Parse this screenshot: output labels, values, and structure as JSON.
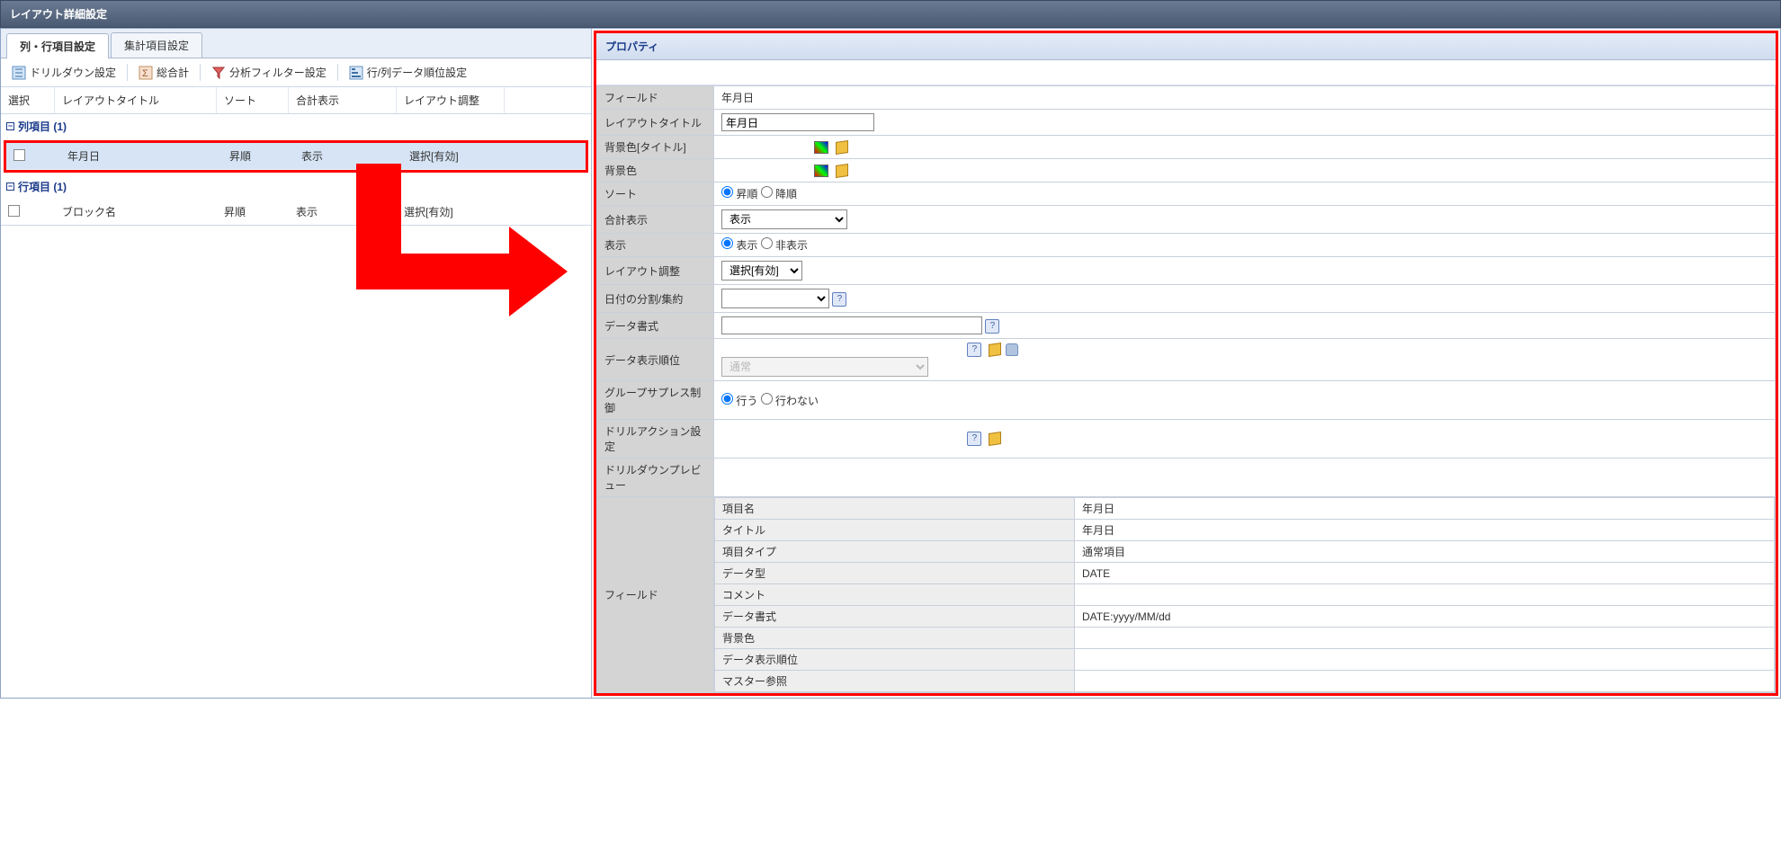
{
  "window": {
    "title": "レイアウト詳細設定"
  },
  "tabs": {
    "tab1": "列・行項目設定",
    "tab2": "集計項目設定"
  },
  "toolbar": {
    "drilldown": "ドリルダウン設定",
    "total": "総合計",
    "filter": "分析フィルター設定",
    "rank": "行/列データ順位設定"
  },
  "grid_headers": {
    "select": "選択",
    "layout_title": "レイアウトタイトル",
    "sort": "ソート",
    "total_display": "合計表示",
    "layout_adjust": "レイアウト調整"
  },
  "groups": {
    "columns": "列項目 (1)",
    "rows": "行項目 (1)"
  },
  "row_col": {
    "title": "年月日",
    "sort": "昇順",
    "total": "表示",
    "adjust": "選択[有効]"
  },
  "row_row": {
    "title": "ブロック名",
    "sort": "昇順",
    "total": "表示",
    "adjust": "選択[有効]"
  },
  "properties": {
    "header": "プロパティ",
    "labels": {
      "field": "フィールド",
      "layout_title": "レイアウトタイトル",
      "bgcolor_title": "背景色[タイトル]",
      "bgcolor": "背景色",
      "sort": "ソート",
      "total_display": "合計表示",
      "display": "表示",
      "layout_adjust": "レイアウト調整",
      "date_split": "日付の分割/集約",
      "data_format": "データ書式",
      "data_rank": "データ表示順位",
      "group_suppress": "グループサプレス制御",
      "drill_action": "ドリルアクション設定",
      "drill_preview": "ドリルダウンプレビュー"
    },
    "values": {
      "field": "年月日",
      "layout_title": "年月日",
      "sort_asc": "昇順",
      "sort_desc": "降順",
      "total_display": "表示",
      "display_show": "表示",
      "display_hide": "非表示",
      "layout_adjust": "選択[有効]",
      "data_rank_normal": "通常",
      "suppress_yes": "行う",
      "suppress_no": "行わない"
    },
    "sub": {
      "labels": {
        "item_name": "項目名",
        "title": "タイトル",
        "item_type": "項目タイプ",
        "data_type": "データ型",
        "comment": "コメント",
        "data_format": "データ書式",
        "bgcolor": "背景色",
        "data_rank": "データ表示順位",
        "master_ref": "マスター参照"
      },
      "values": {
        "item_name": "年月日",
        "title": "年月日",
        "item_type": "通常項目",
        "data_type": "DATE",
        "comment": "",
        "data_format": "DATE:yyyy/MM/dd",
        "bgcolor": "",
        "data_rank": "",
        "master_ref": ""
      }
    }
  }
}
